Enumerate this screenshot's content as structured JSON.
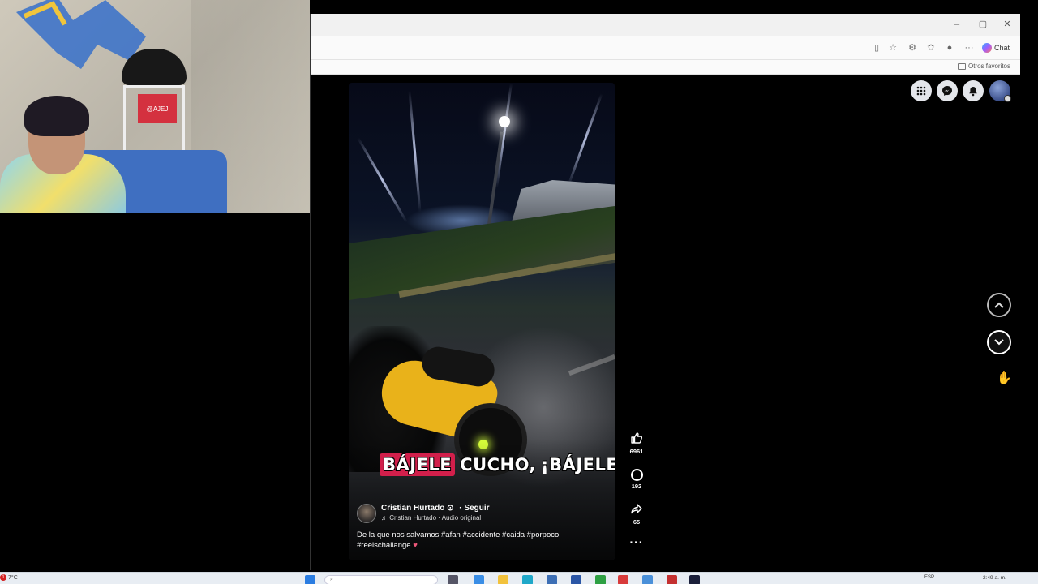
{
  "browser": {
    "window_controls": {
      "minimize": "–",
      "maximize": "▢",
      "close": "✕"
    },
    "chat_label": "Chat",
    "favorites_folder": "Otros favoritos"
  },
  "reel": {
    "caption_highlight": "BÁJELE",
    "caption_rest_1": "CUCHO,",
    "caption_rest_2": "¡BÁJELE",
    "author": {
      "name": "Cristian Hurtado",
      "follow": "· Seguir",
      "audio": "♬ Cristian Hurtado · Audio original"
    },
    "description": "De la que nos salvamos #afan #accidente #caida #porpoco #reelschallange",
    "likes": "6961",
    "comments": "192",
    "shares": "65",
    "more": "···"
  },
  "colors": {
    "caption_highlight_bg": "#d21f4b",
    "reel_moto": "#e9b21a"
  },
  "icons": {
    "menu": "grid-menu-icon",
    "messenger": "messenger-icon",
    "notifications": "bell-icon",
    "like": "thumbs-up-icon",
    "comment": "comment-icon",
    "share": "share-icon",
    "prev": "chevron-up-icon",
    "next": "chevron-down-icon"
  },
  "taskbar": {
    "temperature": "7°C",
    "notification_badge": "1",
    "language": "ESP",
    "time": "2:49 a. m."
  },
  "webcam": {
    "box_label": "@AJEJ"
  }
}
